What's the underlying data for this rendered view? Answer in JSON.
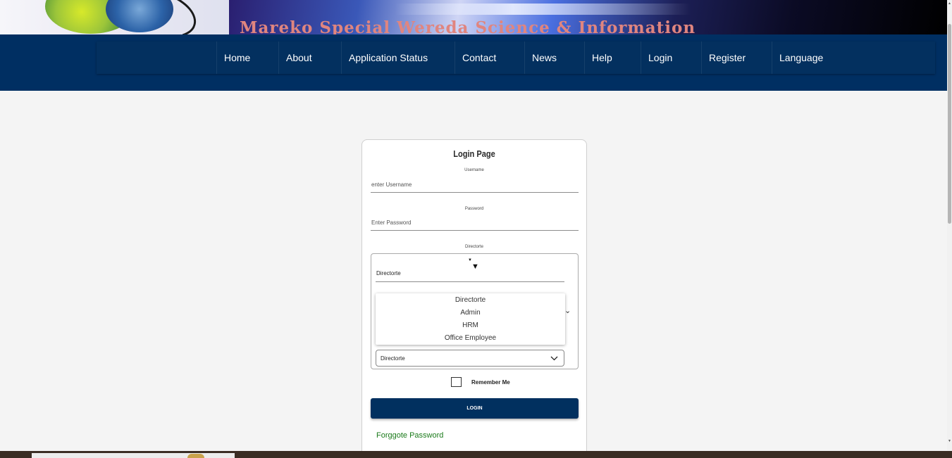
{
  "banner": {
    "title": "Mareko Special Wereda Science & Information"
  },
  "nav": {
    "items": [
      {
        "label": "Home"
      },
      {
        "label": "About"
      },
      {
        "label": "Application Status"
      },
      {
        "label": "Contact"
      },
      {
        "label": "News"
      },
      {
        "label": "Help"
      },
      {
        "label": "Login"
      },
      {
        "label": "Register"
      },
      {
        "label": "Language"
      }
    ]
  },
  "login": {
    "title": "Login Page",
    "username_label": "Username",
    "username_placeholder": "enter Username",
    "password_label": "Password",
    "password_placeholder": "Enter Password",
    "directorate_label": "Directorte",
    "directorate_value": "Directorte",
    "options": [
      "Directorte",
      "Admin",
      "HRM",
      "Office Employee"
    ],
    "select_value": "Directorte",
    "remember_label": "Remember Me",
    "login_button": "LOGIN",
    "forgot_link": "Forggote Password"
  },
  "icons": {
    "dropdown_arrow": "caret-down-icon",
    "chevron": "chevron-down-icon"
  }
}
